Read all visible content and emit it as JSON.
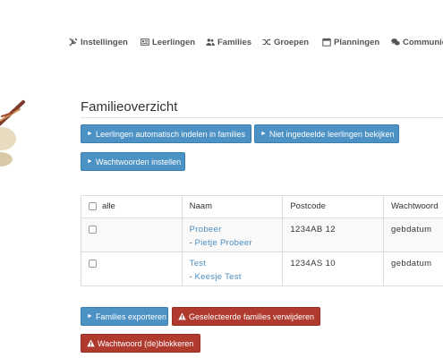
{
  "nav": {
    "items": [
      {
        "label": "Instellingen",
        "icon": "wrench-icon"
      },
      {
        "label": "Leerlingen",
        "icon": "id-card-icon"
      },
      {
        "label": "Families",
        "icon": "users-icon"
      },
      {
        "label": "Groepen",
        "icon": "shuffle-icon"
      },
      {
        "label": "Planningen",
        "icon": "calendar-icon"
      },
      {
        "label": "Communic",
        "icon": "chat-icon"
      }
    ]
  },
  "page": {
    "title": "Familieoverzicht"
  },
  "actions": {
    "auto_assign": "Leerlingen automatisch indelen in families",
    "view_unassigned": "Niet ingedeelde leerlingen bekijken",
    "set_passwords": "Wachtwoorden instellen",
    "export": "Families exporteren",
    "delete_selected": "Geselecteerde families verwijderen",
    "block_password": "Wachtwoord (de)blokkeren"
  },
  "table": {
    "select_all_label": "alle",
    "columns": [
      "Naam",
      "Postcode",
      "Wachtwoord"
    ],
    "rows": [
      {
        "family": "Probeer",
        "member": "Pietje Probeer",
        "postcode": "1234AB 12",
        "password": "gebdatum"
      },
      {
        "family": "Test",
        "member": "Keesje Test",
        "postcode": "1234AS 10",
        "password": "gebdatum"
      }
    ]
  },
  "colors": {
    "primary": "#4d92c4",
    "danger": "#b03a2e",
    "link": "#4d8ec0"
  }
}
